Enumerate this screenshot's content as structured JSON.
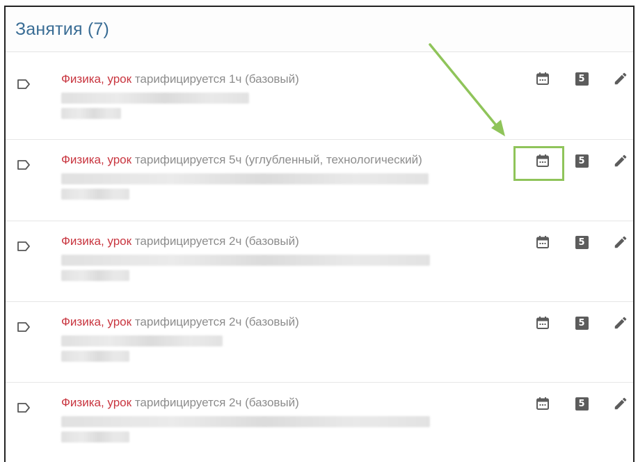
{
  "header": {
    "title": "Занятия (7)"
  },
  "lessons": [
    {
      "subject": "Физика, урок",
      "info": "тарифицируется 1ч (базовый)"
    },
    {
      "subject": "Физика, урок",
      "info": "тарифицируется 5ч (углубленный, технологический)"
    },
    {
      "subject": "Физика, урок",
      "info": "тарифицируется 2ч (базовый)"
    },
    {
      "subject": "Физика, урок",
      "info": "тарифицируется 2ч (базовый)"
    },
    {
      "subject": "Физика, урок",
      "info": "тарифицируется 2ч (базовый)"
    }
  ],
  "actions": {
    "grade_badge": "5",
    "icons": [
      "calendar-icon",
      "grade-5-icon",
      "pencil-icon"
    ]
  },
  "colors": {
    "title": "#3a6d95",
    "subject": "#c8343e",
    "info": "#8c8c8c",
    "icon": "#5c5c5c",
    "highlight": "#8fc45a"
  }
}
